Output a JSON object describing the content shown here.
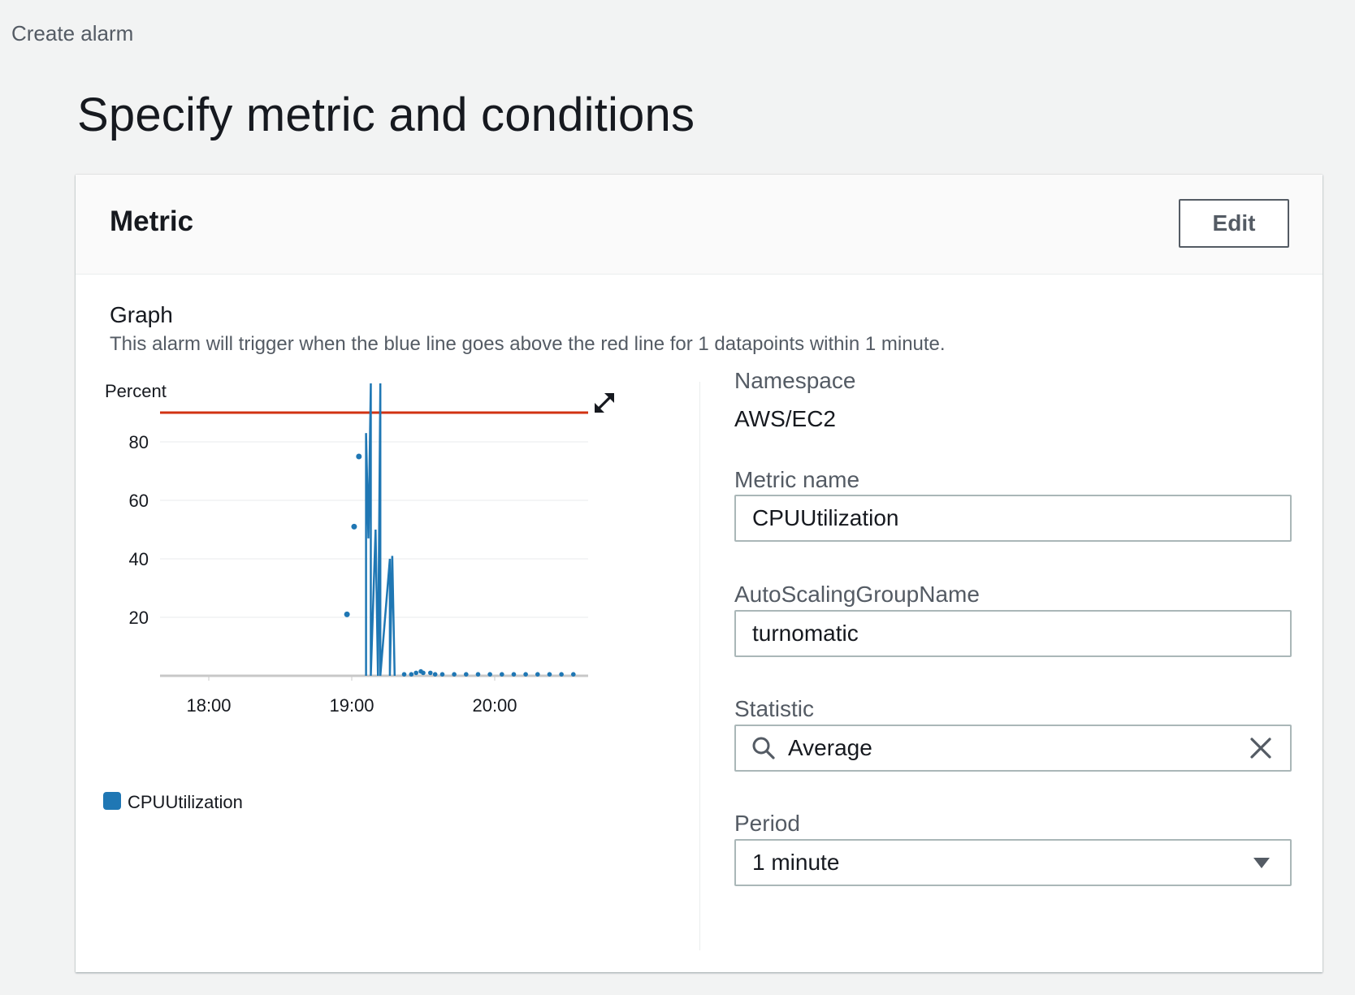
{
  "breadcrumb": "Create alarm",
  "page_title": "Specify metric and conditions",
  "metric_panel": {
    "title": "Metric",
    "edit_label": "Edit"
  },
  "graph": {
    "heading": "Graph",
    "description": "This alarm will trigger when the blue line goes above the red line for 1 datapoints within 1 minute."
  },
  "chart_data": {
    "type": "line",
    "ylabel": "Percent",
    "ylim": [
      0,
      100
    ],
    "yticks": [
      20,
      40,
      60,
      80
    ],
    "xticks": [
      "18:00",
      "19:00",
      "20:00"
    ],
    "threshold": 90,
    "threshold_color": "#d13212",
    "series": [
      {
        "name": "CPUUtilization",
        "color": "#1f77b4",
        "points_isolated": [
          {
            "t": "18:58",
            "v": 21
          },
          {
            "t": "19:01",
            "v": 51
          },
          {
            "t": "19:03",
            "v": 75
          }
        ],
        "line": [
          {
            "t": "19:06",
            "v": 0
          },
          {
            "t": "19:06",
            "v": 83
          },
          {
            "t": "19:07",
            "v": 47
          },
          {
            "t": "19:08",
            "v": 100
          },
          {
            "t": "19:08",
            "v": 0
          },
          {
            "t": "19:10",
            "v": 50
          },
          {
            "t": "19:11",
            "v": 0
          },
          {
            "t": "19:12",
            "v": 100
          },
          {
            "t": "19:12",
            "v": 0
          },
          {
            "t": "19:16",
            "v": 40
          },
          {
            "t": "19:16",
            "v": 0
          },
          {
            "t": "19:17",
            "v": 41
          },
          {
            "t": "19:18",
            "v": 0
          }
        ],
        "tail_dots": [
          {
            "t": "19:22",
            "v": 0.5
          },
          {
            "t": "19:25",
            "v": 0.5
          },
          {
            "t": "19:27",
            "v": 1
          },
          {
            "t": "19:29",
            "v": 1.5
          },
          {
            "t": "19:30",
            "v": 1
          },
          {
            "t": "19:33",
            "v": 1
          },
          {
            "t": "19:35",
            "v": 0.5
          },
          {
            "t": "19:38",
            "v": 0.5
          },
          {
            "t": "19:43",
            "v": 0.5
          },
          {
            "t": "19:48",
            "v": 0.5
          },
          {
            "t": "19:53",
            "v": 0.5
          },
          {
            "t": "19:58",
            "v": 0.5
          },
          {
            "t": "20:03",
            "v": 0.5
          },
          {
            "t": "20:08",
            "v": 0.5
          },
          {
            "t": "20:13",
            "v": 0.5
          },
          {
            "t": "20:18",
            "v": 0.5
          },
          {
            "t": "20:23",
            "v": 0.5
          },
          {
            "t": "20:28",
            "v": 0.5
          },
          {
            "t": "20:33",
            "v": 0.5
          }
        ]
      }
    ],
    "legend": [
      "CPUUtilization"
    ]
  },
  "details": {
    "namespace_label": "Namespace",
    "namespace_value": "AWS/EC2",
    "metric_name_label": "Metric name",
    "metric_name_value": "CPUUtilization",
    "asg_label": "AutoScalingGroupName",
    "asg_value": "turnomatic",
    "statistic_label": "Statistic",
    "statistic_value": "Average",
    "period_label": "Period",
    "period_value": "1 minute"
  },
  "icons": {
    "expand": "expand-icon",
    "search": "search-icon",
    "clear": "close-icon",
    "dropdown": "caret-down-icon"
  }
}
